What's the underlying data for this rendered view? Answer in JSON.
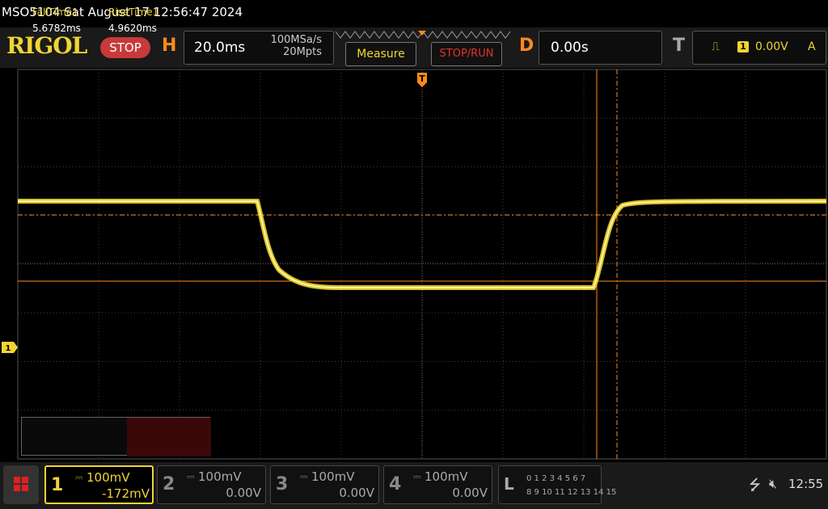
{
  "header": {
    "device_info": "MSO5104  Sat August 17 12:56:47 2024"
  },
  "top_bar": {
    "logo": "RIGOL",
    "run_state": "STOP",
    "horizontal": {
      "letter": "H",
      "timebase": "20.0ms",
      "sample_rate": "100MSa/s",
      "memory_depth": "20Mpts"
    },
    "measure_button": "Measure",
    "stoprun_button": "STOP/RUN",
    "delay": {
      "letter": "D",
      "value": "0.00s"
    },
    "trigger": {
      "letter": "T",
      "source": "1",
      "level": "0.00V",
      "mode": "A"
    }
  },
  "measurements": {
    "items": [
      {
        "label": "FallTime1",
        "value": "5.6782ms"
      },
      {
        "label": "RiseTime1",
        "value": "4.9620ms"
      }
    ]
  },
  "channels": [
    {
      "number": "1",
      "scale": "100mV",
      "offset": "-172mV",
      "active": true,
      "color": "#f1d531"
    },
    {
      "number": "2",
      "scale": "100mV",
      "offset": "0.00V",
      "active": false
    },
    {
      "number": "3",
      "scale": "100mV",
      "offset": "0.00V",
      "active": false
    },
    {
      "number": "4",
      "scale": "100mV",
      "offset": "0.00V",
      "active": false
    }
  ],
  "logic": {
    "letter": "L",
    "row1": "0 1 2 3  4 5 6 7",
    "row2": "8 9 10 11 12 13 14 15"
  },
  "status": {
    "time": "12:55",
    "icons": [
      "usb-icon",
      "speaker-muted-icon"
    ]
  },
  "markers": {
    "trigger_marker": "T",
    "channel1_marker": "1"
  },
  "colors": {
    "channel1": "#f1d531",
    "cursor": "#ff8a1a",
    "stop": "#c83a3a",
    "stoprun_text": "#e5322a",
    "rise_highlight": "#3a0808"
  }
}
